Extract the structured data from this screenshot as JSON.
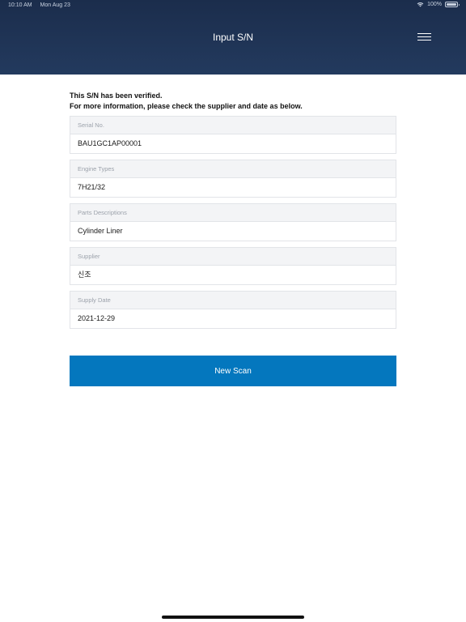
{
  "status_bar": {
    "time": "10:10 AM",
    "date": "Mon Aug 23",
    "battery": "100%",
    "wifi_icon": "wifi-icon",
    "battery_icon": "battery-icon"
  },
  "header": {
    "title": "Input S/N",
    "menu_icon": "hamburger-menu-icon"
  },
  "message": {
    "line1": "This S/N has been verified.",
    "line2": "For more information, please check the supplier and date as below."
  },
  "fields": [
    {
      "label": "Serial No.",
      "value": "BAU1GC1AP00001"
    },
    {
      "label": "Engine Types",
      "value": "7H21/32"
    },
    {
      "label": "Parts Descriptions",
      "value": "Cylinder Liner"
    },
    {
      "label": "Supplier",
      "value": "신조"
    },
    {
      "label": "Supply Date",
      "value": "2021-12-29"
    }
  ],
  "actions": {
    "new_scan_label": "New Scan"
  },
  "colors": {
    "header_bg": "#1b2d4c",
    "button_bg": "#0477be",
    "label_bg": "#f3f4f6",
    "border": "#e2e4e8"
  }
}
